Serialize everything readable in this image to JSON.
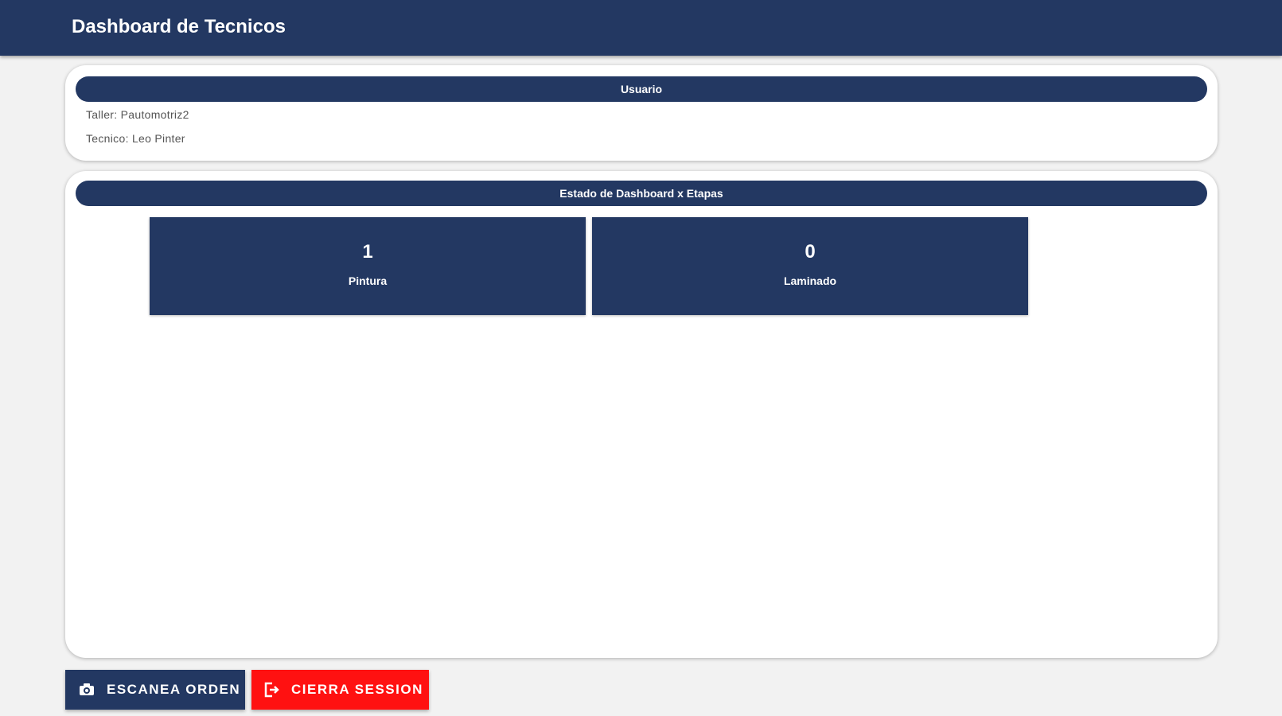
{
  "header": {
    "title": "Dashboard de Tecnicos"
  },
  "user_card": {
    "header": "Usuario",
    "taller": "Taller: Pautomotriz2",
    "tecnico": "Tecnico: Leo Pinter"
  },
  "dashboard_card": {
    "header": "Estado de Dashboard x Etapas",
    "stages": [
      {
        "count": "1",
        "label": "Pintura"
      },
      {
        "count": "0",
        "label": "Laminado"
      }
    ]
  },
  "actions": {
    "scan_label": "ESCANEA ORDEN",
    "scan_icon": "camera-icon",
    "logout_label": "CIERRA SESSION",
    "logout_icon": "exit-icon"
  },
  "colors": {
    "primary": "#233862",
    "danger": "#ff1111",
    "background": "#f2f2f2"
  }
}
